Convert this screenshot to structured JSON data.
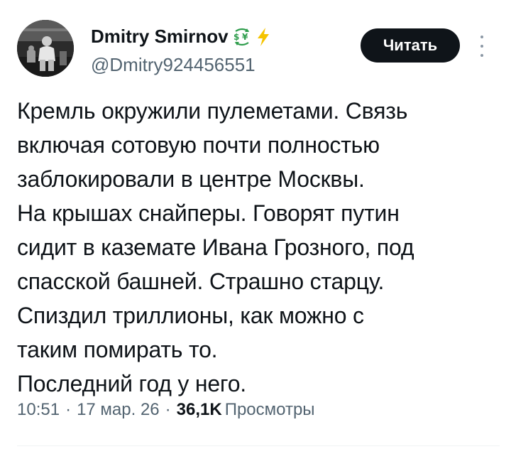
{
  "author": {
    "display_name": "Dmitry Smirnov",
    "emoji_badges": [
      "currency-exchange-emoji",
      "lightning-emoji"
    ],
    "handle": "@Dmitry924456551",
    "avatar": "avatar-photo"
  },
  "follow_button": {
    "label": "Читать"
  },
  "more_menu": {
    "icon": "more-vertical-icon"
  },
  "tweet": {
    "lines": [
      "Кремль окружили пулеметами. Связь",
      "включая сотовую почти полностью",
      "заблокировали в центре Москвы.",
      "На крышах снайперы. Говорят путин",
      "сидит в каземате Ивана Грозного, под",
      "спасской башней. Страшно старцу.",
      "Спиздил триллионы, как можно с",
      "таким помирать то.",
      "Последний год у него."
    ]
  },
  "meta": {
    "time": "10:51",
    "separator": "·",
    "date": "17 мар. 26",
    "views_count": "36,1K",
    "views_label": "Просмотры"
  },
  "colors": {
    "text": "#0f1419",
    "secondary": "#536471",
    "button_bg": "#0f1419",
    "lightning": "#f5c400",
    "exchange": "#2e9d4c"
  }
}
